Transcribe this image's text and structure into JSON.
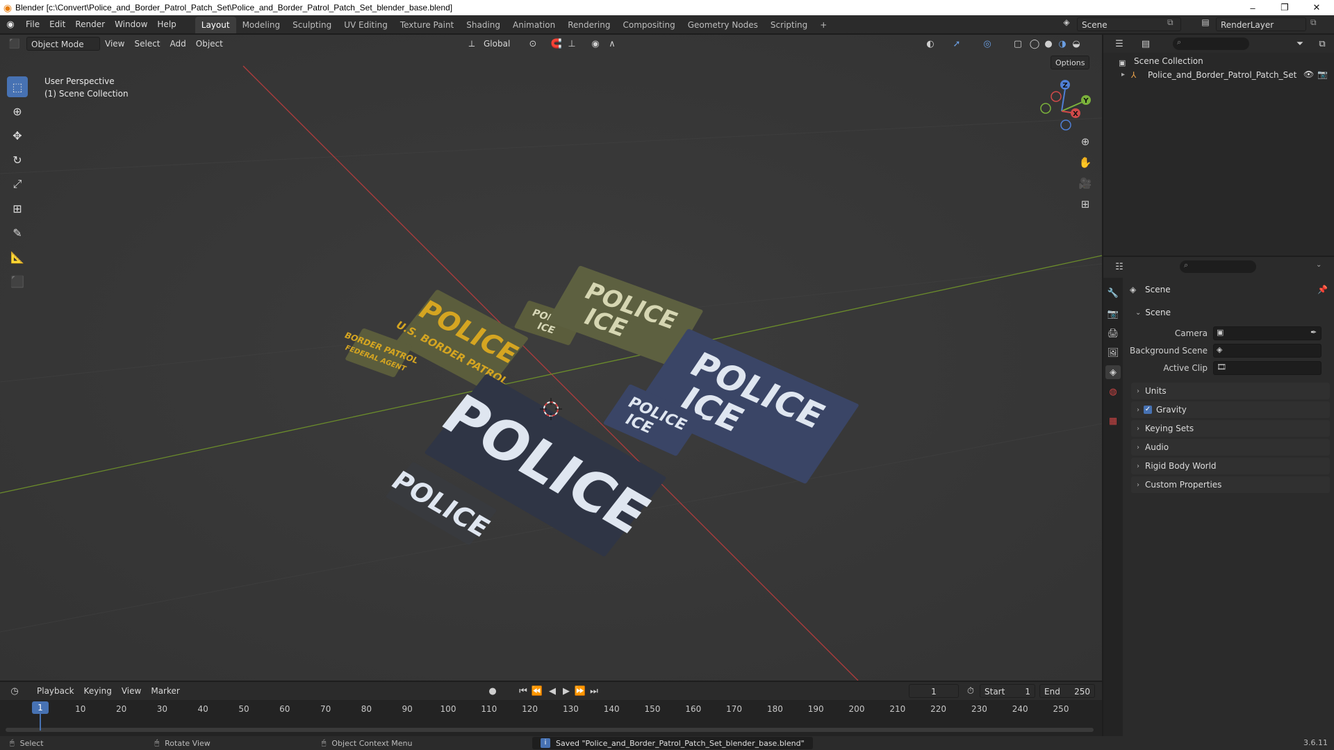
{
  "window": {
    "title": "Blender [c:\\Convert\\Police_and_Border_Patrol_Patch_Set\\Police_and_Border_Patrol_Patch_Set_blender_base.blend]",
    "minimize": "–",
    "maximize": "❐",
    "close": "✕"
  },
  "topbar": {
    "menus": [
      "File",
      "Edit",
      "Render",
      "Window",
      "Help"
    ],
    "workspaces": [
      "Layout",
      "Modeling",
      "Sculpting",
      "UV Editing",
      "Texture Paint",
      "Shading",
      "Animation",
      "Rendering",
      "Compositing",
      "Geometry Nodes",
      "Scripting"
    ],
    "active_workspace": "Layout",
    "add_tab": "+",
    "scene_name": "Scene",
    "view_layer": "RenderLayer"
  },
  "viewport_header": {
    "mode": "Object Mode",
    "menus": [
      "View",
      "Select",
      "Add",
      "Object"
    ],
    "transform_orientation": "Global",
    "options": "Options"
  },
  "viewport": {
    "perspective": "User Perspective",
    "collection": "(1) Scene Collection",
    "gizmo": {
      "x": "X",
      "y": "Y",
      "z": "Z"
    },
    "patches": {
      "p1": "POLICE",
      "p2": "POLICE",
      "p3_line1": "POLICE",
      "p3_line2": "ICE",
      "p4_line1": "POLICE",
      "p4_line2": "ICE",
      "p5_line1": "POLICE",
      "p5_line2": "ICE",
      "p6_line1": "POLICE",
      "p6_line2": "ICE",
      "p7_line1": "POLICE",
      "p7_line2": "U.S. BORDER PATROL",
      "p8_line1": "BORDER PATROL",
      "p8_line2": "FEDERAL AGENT"
    },
    "colors": {
      "navy": "#3a4566",
      "olive": "#5b5d3c",
      "gold": "#d5a521",
      "white_text": "#dfe6f0"
    }
  },
  "outliner": {
    "root": "Scene Collection",
    "items": [
      {
        "name": "Police_and_Border_Patrol_Patch_Set"
      }
    ]
  },
  "properties": {
    "header": "Scene",
    "section_scene": "Scene",
    "fields": {
      "camera": "Camera",
      "background_scene": "Background Scene",
      "active_clip": "Active Clip"
    },
    "panels": [
      "Units",
      "Gravity",
      "Keying Sets",
      "Audio",
      "Rigid Body World",
      "Custom Properties"
    ],
    "gravity_checked": true
  },
  "timeline": {
    "menus": [
      "Playback",
      "Keying",
      "View",
      "Marker"
    ],
    "current_frame": "1",
    "start_label": "Start",
    "start": "1",
    "end_label": "End",
    "end": "250",
    "frames": [
      "10",
      "20",
      "30",
      "40",
      "50",
      "60",
      "70",
      "80",
      "90",
      "100",
      "110",
      "120",
      "130",
      "140",
      "150",
      "160",
      "170",
      "180",
      "190",
      "200",
      "210",
      "220",
      "230",
      "240",
      "250"
    ],
    "playhead": "1"
  },
  "statusbar": {
    "select": "Select",
    "rotate": "Rotate View",
    "context": "Object Context Menu",
    "message": "Saved \"Police_and_Border_Patrol_Patch_Set_blender_base.blend\"",
    "version": "3.6.11"
  }
}
